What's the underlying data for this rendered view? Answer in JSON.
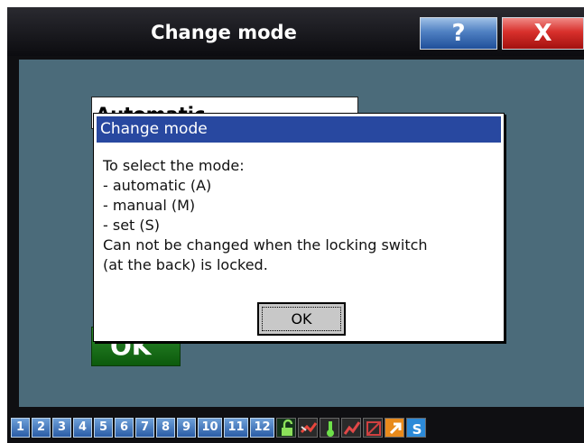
{
  "window": {
    "title": "Change mode",
    "help_label": "?",
    "close_label": "X"
  },
  "mode_select": {
    "value": "Automatic"
  },
  "background_ok": {
    "label": "OK"
  },
  "dialog": {
    "title": "Change mode",
    "lines": [
      "To select the mode:",
      "- automatic (A)",
      "- manual (M)",
      "- set (S)",
      "Can not be changed when the locking switch",
      "(at the back) is locked."
    ],
    "ok_label": "OK"
  },
  "taskbar": {
    "tabs": [
      "1",
      "2",
      "3",
      "4",
      "5",
      "6",
      "7",
      "8",
      "9",
      "10",
      "11",
      "12"
    ],
    "icons": [
      "lock-open-icon",
      "wind-icon",
      "thermometer-icon",
      "graph-icon",
      "flag-icon",
      "arrow-icon",
      "s-icon"
    ]
  },
  "colors": {
    "content_bg": "#4b6b7a",
    "dialog_title_bg": "#2848a0",
    "help_button": "#3c6fb6",
    "close_button": "#d0302c",
    "ok_green": "#1f7a1f"
  }
}
